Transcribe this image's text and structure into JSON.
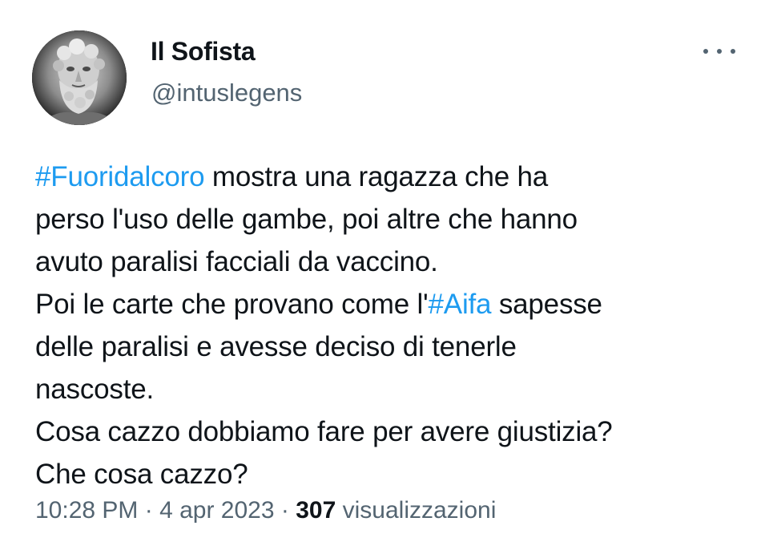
{
  "author": {
    "display_name": "Il Sofista",
    "handle": "@intuslegens",
    "avatar_icon": "bearded-bust-avatar"
  },
  "more_icon": "more-horizontal-icon",
  "tweet": {
    "hashtag1": "#Fuoridalcoro",
    "line1_rest": " mostra una ragazza che ha",
    "line2": "perso l'uso delle gambe, poi altre che hanno",
    "line3": "avuto paralisi facciali da vaccino.",
    "line4_pre": "Poi le carte che provano come l'",
    "hashtag2": "#Aifa",
    "line4_post": " sapesse",
    "line5": "delle paralisi e avesse deciso di tenerle",
    "line6": "nascoste.",
    "line7": "Cosa cazzo dobbiamo fare per avere giustizia?",
    "line8": "Che cosa cazzo?"
  },
  "meta": {
    "time": "10:28 PM",
    "sep1": " · ",
    "date": "4 apr 2023",
    "sep2": " · ",
    "views_count": "307",
    "views_label": " visualizzazioni"
  },
  "colors": {
    "text": "#0f1419",
    "secondary": "#536471",
    "link": "#1d9bf0"
  }
}
